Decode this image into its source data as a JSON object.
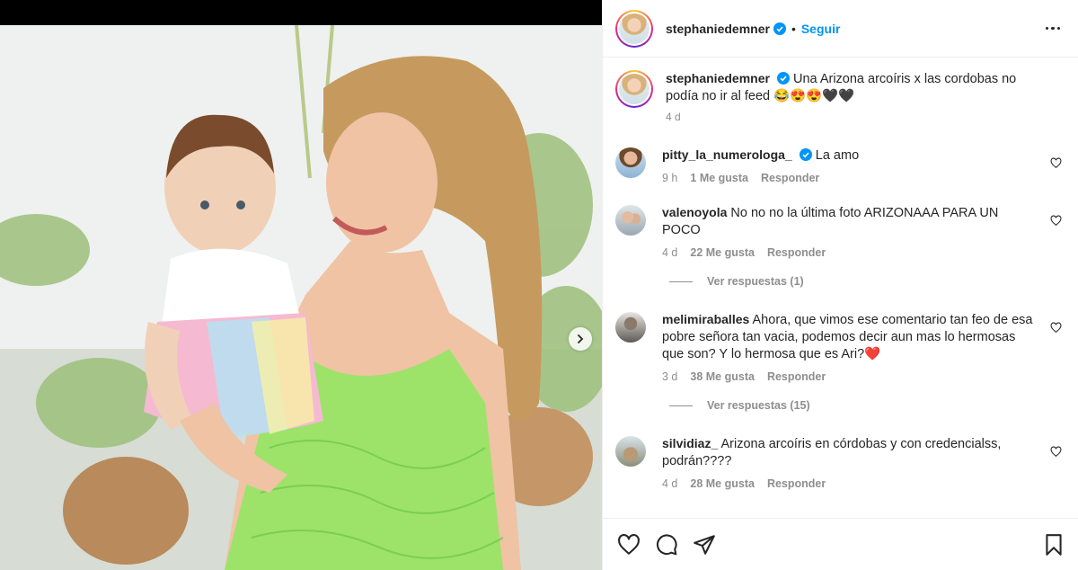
{
  "post": {
    "author": "stephaniedemner",
    "separator": "•",
    "follow_label": "Seguir",
    "caption": "Una Arizona arcoíris x las cordobas no podía no ir al feed 😂😍😍🖤🖤",
    "caption_time": "4 d"
  },
  "comments": [
    {
      "user": "pitty_la_numerologa_",
      "verified": true,
      "text": "La amo",
      "time": "9 h",
      "likes": "1 Me gusta",
      "reply": "Responder"
    },
    {
      "user": "valenoyola",
      "text": "No no no la última foto ARIZONAAA PARA UN POCO",
      "time": "4 d",
      "likes": "22 Me gusta",
      "reply": "Responder",
      "replies": "Ver respuestas (1)"
    },
    {
      "user": "melimiraballes",
      "text": "Ahora, que vimos ese comentario tan feo de esa pobre señora tan vacia, podemos decir aun mas lo hermosas que son? Y lo hermosa que es Ari?❤️",
      "time": "3 d",
      "likes": "38 Me gusta",
      "reply": "Responder",
      "replies": "Ver respuestas (15)"
    },
    {
      "user": "silvidiaz_",
      "text": "Arizona arcoíris en córdobas y con credencialss, podrán????",
      "time": "4 d",
      "likes": "28 Me gusta",
      "reply": "Responder"
    }
  ],
  "icons": {
    "verified": "verified-badge-icon",
    "more": "more-options-icon",
    "next": "chevron-right-icon",
    "like": "heart-icon",
    "comment": "comment-bubble-icon",
    "share": "paper-plane-icon",
    "save": "bookmark-icon"
  },
  "colors": {
    "accent": "#0095f6",
    "text": "#262626",
    "muted": "#8e8e8e",
    "divider": "#efefef"
  }
}
